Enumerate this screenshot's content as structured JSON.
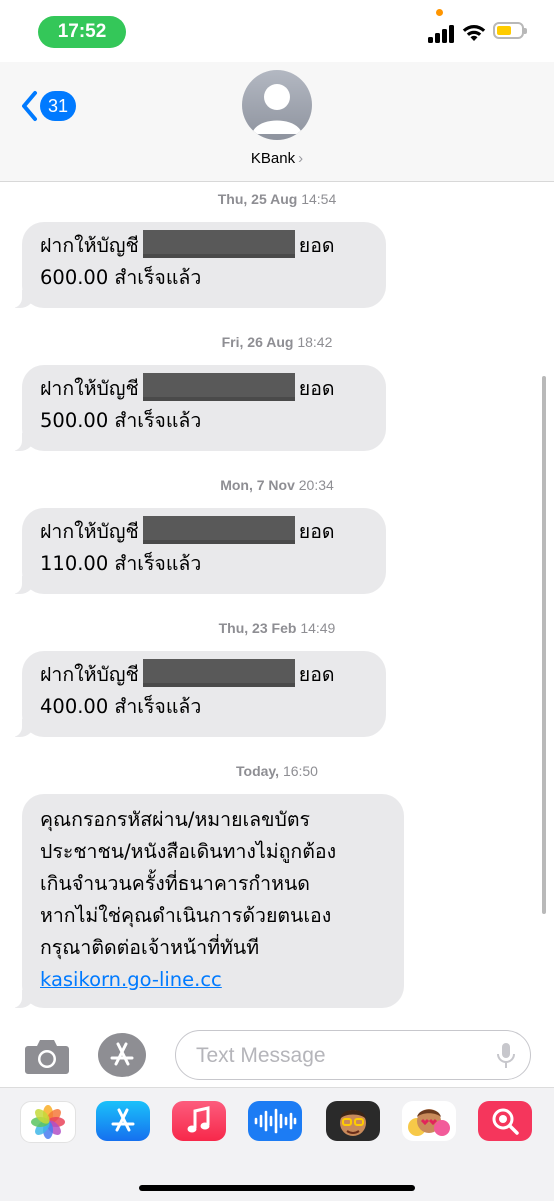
{
  "status_bar": {
    "time": "17:52"
  },
  "header": {
    "back_count": "31",
    "contact_name": "KBank",
    "chevron": "›"
  },
  "messages": [
    {
      "timestamp_day": "Thu, 25 Aug",
      "timestamp_time": "14:54",
      "text_prefix": "ฝากให้บัญชี",
      "text_suffix": "ยอด",
      "line2": "600.00 สำเร็จแล้ว"
    },
    {
      "timestamp_day": "Fri, 26 Aug",
      "timestamp_time": "18:42",
      "text_prefix": "ฝากให้บัญชี",
      "text_suffix": "ยอด",
      "line2": "500.00 สำเร็จแล้ว"
    },
    {
      "timestamp_day": "Mon, 7 Nov",
      "timestamp_time": "20:34",
      "text_prefix": "ฝากให้บัญชี",
      "text_suffix": "ยอด",
      "line2": "110.00 สำเร็จแล้ว"
    },
    {
      "timestamp_day": "Thu, 23 Feb",
      "timestamp_time": "14:49",
      "text_prefix": "ฝากให้บัญชี",
      "text_suffix": "ยอด",
      "line2": "400.00 สำเร็จแล้ว"
    }
  ],
  "latest": {
    "timestamp_day": "Today,",
    "timestamp_time": "16:50",
    "lines": [
      "คุณกรอกรหัสผ่าน/หมายเลขบัตร",
      "ประชาชน/หนังสือเดินทางไม่ถูกต้อง",
      "เกินจำนวนครั้งที่ธนาคารกำหนด",
      "หากไม่ใช่คุณดำเนินการด้วยตนเอง",
      "กรุณาติดต่อเจ้าหน้าที่ทันที"
    ],
    "link": "kasikorn.go-line.cc"
  },
  "input": {
    "placeholder": "Text Message",
    "value": ""
  },
  "app_drawer": [
    "photos-icon",
    "app-store-icon",
    "music-icon",
    "audio-message-icon",
    "memoji-icon",
    "memoji-stickers-icon",
    "images-search-icon"
  ],
  "colors": {
    "status_green": "#34c759",
    "accent_blue": "#007aff",
    "bubble_gray": "#e9e9eb",
    "battery_yellow": "#ffcc00"
  }
}
